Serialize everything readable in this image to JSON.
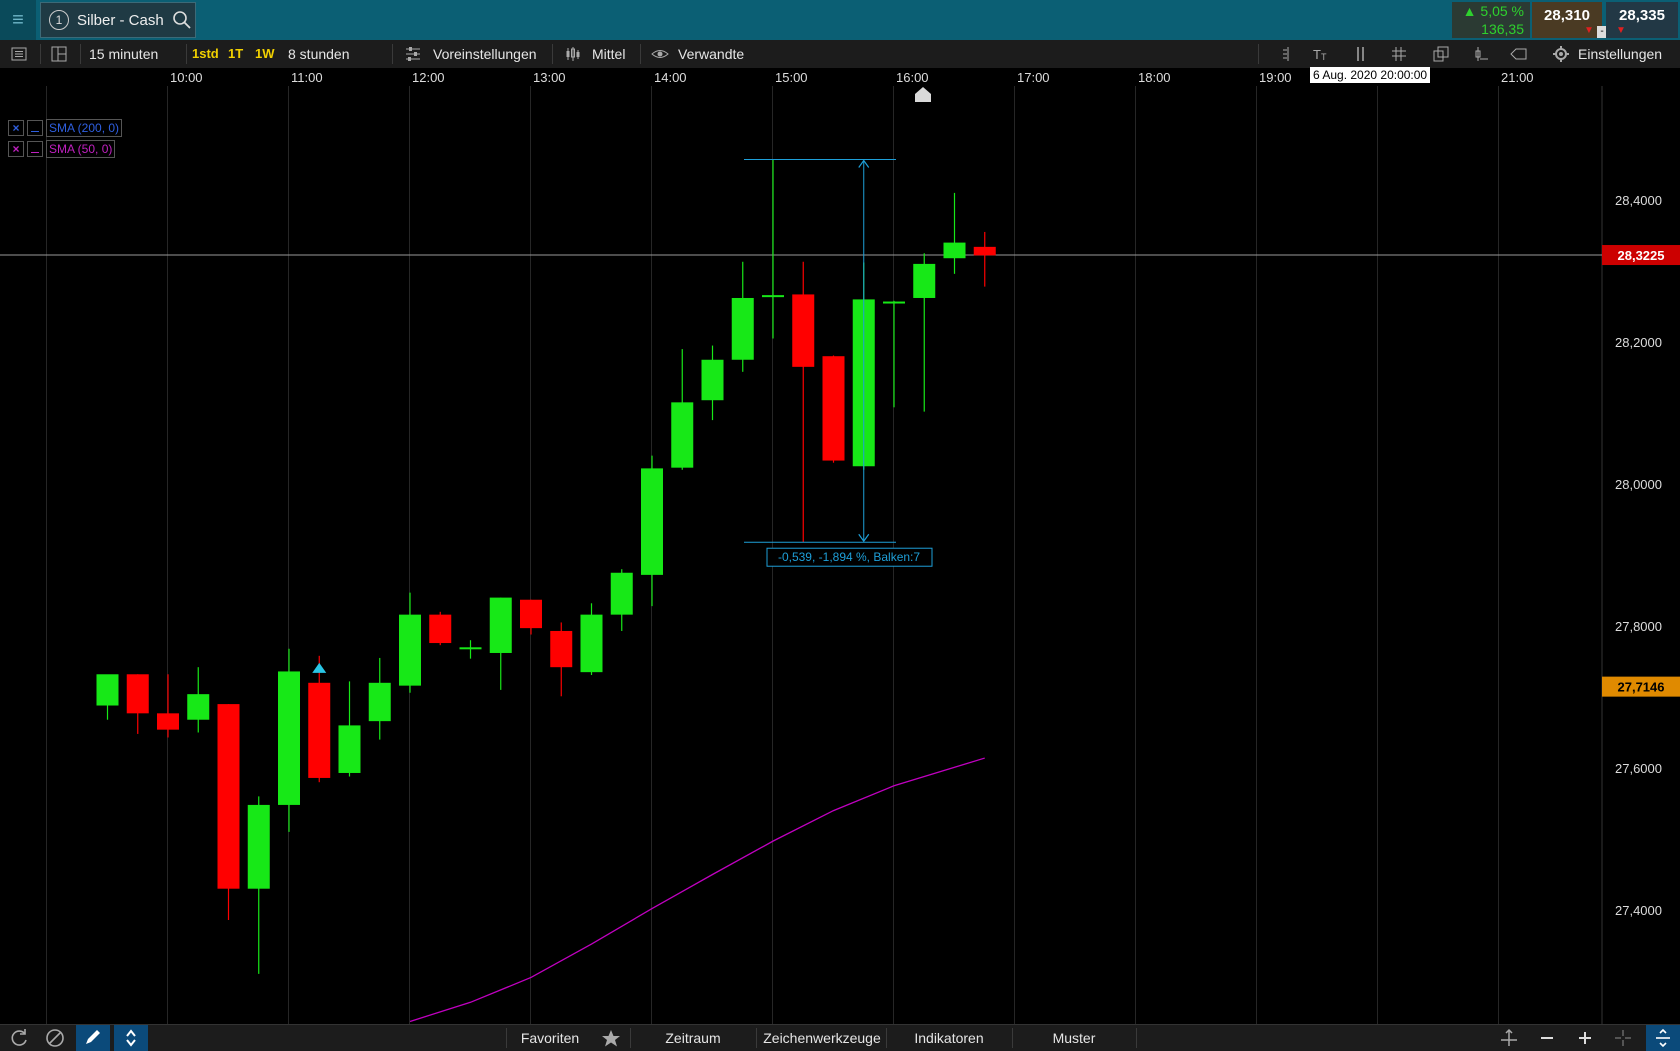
{
  "header": {
    "instrument_number": "1",
    "instrument_name": "Silber - Cash",
    "change_pct": "▲ 5,05 %",
    "change_abs": "136,35",
    "bid": "28,310",
    "ask": "28,335",
    "spread_marker": "-"
  },
  "toolbar": {
    "interval": "15 minuten",
    "quick_1std": "1std",
    "quick_1t": "1T",
    "quick_1w": "1W",
    "range": "8 stunden",
    "presets": "Voreinstellungen",
    "candle_type": "Mittel",
    "related": "Verwandte",
    "settings": "Einstellungen"
  },
  "time_axis": [
    "10:00",
    "11:00",
    "12:00",
    "13:00",
    "14:00",
    "15:00",
    "16:00",
    "17:00",
    "18:00",
    "19:00",
    "21:00"
  ],
  "date_tooltip": "6 Aug. 2020 20:00:00",
  "price_axis": [
    "28,4000",
    "28,2000",
    "28,0000",
    "27,8000",
    "27,6000",
    "27,4000"
  ],
  "price_markers": {
    "last": "28,3225",
    "sma50_value": "27,7146"
  },
  "legend": [
    {
      "label": "SMA (200, 0)",
      "color": "#2f5fe0"
    },
    {
      "label": "SMA (50, 0)",
      "color": "#c020c0"
    }
  ],
  "measure_label": "-0,539, -1,894 %, Balken:7",
  "bottom_bar": {
    "favorites": "Favoriten",
    "period": "Zeitraum",
    "drawing_tools": "Zeichenwerkzeuge",
    "indicators": "Indikatoren",
    "patterns": "Muster"
  },
  "colors": {
    "up": "#17e817",
    "down": "#ff0000",
    "sma50": "#c000c0",
    "measure": "#1e9fd8",
    "last_price_bg": "#cc0000",
    "sma_marker_bg": "#e08a00"
  },
  "chart_data": {
    "type": "candlestick",
    "interval_minutes": 15,
    "ylim": [
      27.25,
      28.52
    ],
    "candles": [
      {
        "time": "09:30",
        "open": 27.688,
        "high": 27.712,
        "low": 27.668,
        "close": 27.732
      },
      {
        "time": "09:45",
        "open": 27.732,
        "high": 27.732,
        "low": 27.648,
        "close": 27.677
      },
      {
        "time": "10:00",
        "open": 27.677,
        "high": 27.732,
        "low": 27.643,
        "close": 27.654
      },
      {
        "time": "10:15",
        "open": 27.668,
        "high": 27.742,
        "low": 27.65,
        "close": 27.704
      },
      {
        "time": "10:30",
        "open": 27.69,
        "high": 27.69,
        "low": 27.386,
        "close": 27.43
      },
      {
        "time": "10:45",
        "open": 27.43,
        "high": 27.56,
        "low": 27.31,
        "close": 27.548
      },
      {
        "time": "11:00",
        "open": 27.548,
        "high": 27.768,
        "low": 27.51,
        "close": 27.736
      },
      {
        "time": "11:15",
        "open": 27.72,
        "high": 27.758,
        "low": 27.58,
        "close": 27.586
      },
      {
        "time": "11:30",
        "open": 27.593,
        "high": 27.722,
        "low": 27.588,
        "close": 27.66
      },
      {
        "time": "11:45",
        "open": 27.666,
        "high": 27.755,
        "low": 27.64,
        "close": 27.72
      },
      {
        "time": "12:00",
        "open": 27.716,
        "high": 27.847,
        "low": 27.706,
        "close": 27.816
      },
      {
        "time": "12:15",
        "open": 27.816,
        "high": 27.82,
        "low": 27.773,
        "close": 27.776
      },
      {
        "time": "12:30",
        "open": 27.77,
        "high": 27.78,
        "low": 27.754,
        "close": 27.77
      },
      {
        "time": "12:45",
        "open": 27.762,
        "high": 27.84,
        "low": 27.71,
        "close": 27.84
      },
      {
        "time": "13:00",
        "open": 27.837,
        "high": 27.837,
        "low": 27.788,
        "close": 27.797
      },
      {
        "time": "13:15",
        "open": 27.793,
        "high": 27.805,
        "low": 27.701,
        "close": 27.742
      },
      {
        "time": "13:30",
        "open": 27.735,
        "high": 27.832,
        "low": 27.731,
        "close": 27.816
      },
      {
        "time": "13:45",
        "open": 27.816,
        "high": 27.88,
        "low": 27.793,
        "close": 27.875
      },
      {
        "time": "14:00",
        "open": 27.872,
        "high": 28.04,
        "low": 27.828,
        "close": 28.022
      },
      {
        "time": "14:15",
        "open": 28.023,
        "high": 28.19,
        "low": 28.02,
        "close": 28.115
      },
      {
        "time": "14:30",
        "open": 28.118,
        "high": 28.195,
        "low": 28.09,
        "close": 28.175
      },
      {
        "time": "14:45",
        "open": 28.175,
        "high": 28.313,
        "low": 28.158,
        "close": 28.262
      },
      {
        "time": "15:00",
        "open": 28.266,
        "high": 28.457,
        "low": 28.205,
        "close": 28.266
      },
      {
        "time": "15:15",
        "open": 28.267,
        "high": 28.313,
        "low": 27.918,
        "close": 28.165
      },
      {
        "time": "15:30",
        "open": 28.18,
        "high": 28.181,
        "low": 28.03,
        "close": 28.033
      },
      {
        "time": "15:45",
        "open": 28.025,
        "high": 28.312,
        "low": 28.02,
        "close": 28.26
      },
      {
        "time": "16:00",
        "open": 28.257,
        "high": 28.258,
        "low": 28.108,
        "close": 28.257
      },
      {
        "time": "16:15",
        "open": 28.262,
        "high": 28.325,
        "low": 28.102,
        "close": 28.31
      },
      {
        "time": "16:30",
        "open": 28.318,
        "high": 28.41,
        "low": 28.296,
        "close": 28.34
      },
      {
        "time": "16:45",
        "open": 28.334,
        "high": 28.355,
        "low": 28.278,
        "close": 28.322
      }
    ],
    "sma50": [
      {
        "time": "12:00",
        "value": 27.243
      },
      {
        "time": "12:30",
        "value": 27.27
      },
      {
        "time": "13:00",
        "value": 27.305
      },
      {
        "time": "13:30",
        "value": 27.352
      },
      {
        "time": "14:00",
        "value": 27.402
      },
      {
        "time": "14:30",
        "value": 27.45
      },
      {
        "time": "15:00",
        "value": 27.497
      },
      {
        "time": "15:30",
        "value": 27.54
      },
      {
        "time": "16:00",
        "value": 27.575
      },
      {
        "time": "16:45",
        "value": 27.614
      }
    ]
  }
}
